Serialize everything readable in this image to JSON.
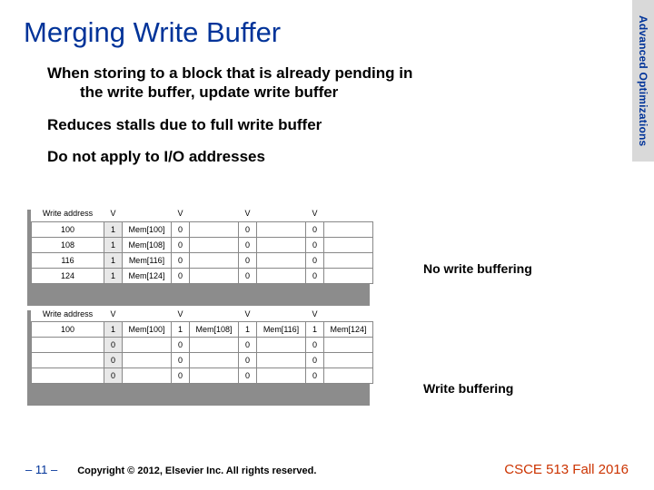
{
  "sidebar_label": "Advanced Optimizations",
  "title": "Merging Write Buffer",
  "bullets": {
    "b1_line1": "When storing to a block that is already pending in",
    "b1_line2": "the write buffer, update write buffer",
    "b2": "Reduces stalls due to full write buffer",
    "b3": "Do not apply to I/O addresses"
  },
  "labels": {
    "no_buffering": "No write buffering",
    "buffering": "Write buffering"
  },
  "table_headers": {
    "addr": "Write address",
    "v": "V"
  },
  "table1": {
    "rows": [
      {
        "addr": "100",
        "v0": "1",
        "m0": "Mem[100]",
        "v1": "0",
        "m1": "",
        "v2": "0",
        "m2": "",
        "v3": "0",
        "m3": ""
      },
      {
        "addr": "108",
        "v0": "1",
        "m0": "Mem[108]",
        "v1": "0",
        "m1": "",
        "v2": "0",
        "m2": "",
        "v3": "0",
        "m3": ""
      },
      {
        "addr": "116",
        "v0": "1",
        "m0": "Mem[116]",
        "v1": "0",
        "m1": "",
        "v2": "0",
        "m2": "",
        "v3": "0",
        "m3": ""
      },
      {
        "addr": "124",
        "v0": "1",
        "m0": "Mem[124]",
        "v1": "0",
        "m1": "",
        "v2": "0",
        "m2": "",
        "v3": "0",
        "m3": ""
      }
    ]
  },
  "table2": {
    "rows": [
      {
        "addr": "100",
        "v0": "1",
        "m0": "Mem[100]",
        "v1": "1",
        "m1": "Mem[108]",
        "v2": "1",
        "m2": "Mem[116]",
        "v3": "1",
        "m3": "Mem[124]"
      },
      {
        "addr": "",
        "v0": "0",
        "m0": "",
        "v1": "0",
        "m1": "",
        "v2": "0",
        "m2": "",
        "v3": "0",
        "m3": ""
      },
      {
        "addr": "",
        "v0": "0",
        "m0": "",
        "v1": "0",
        "m1": "",
        "v2": "0",
        "m2": "",
        "v3": "0",
        "m3": ""
      },
      {
        "addr": "",
        "v0": "0",
        "m0": "",
        "v1": "0",
        "m1": "",
        "v2": "0",
        "m2": "",
        "v3": "0",
        "m3": ""
      }
    ]
  },
  "footer": {
    "page": "– 11 –",
    "copyright": "Copyright © 2012, Elsevier Inc. All rights reserved.",
    "course": "CSCE 513 Fall 2016"
  }
}
